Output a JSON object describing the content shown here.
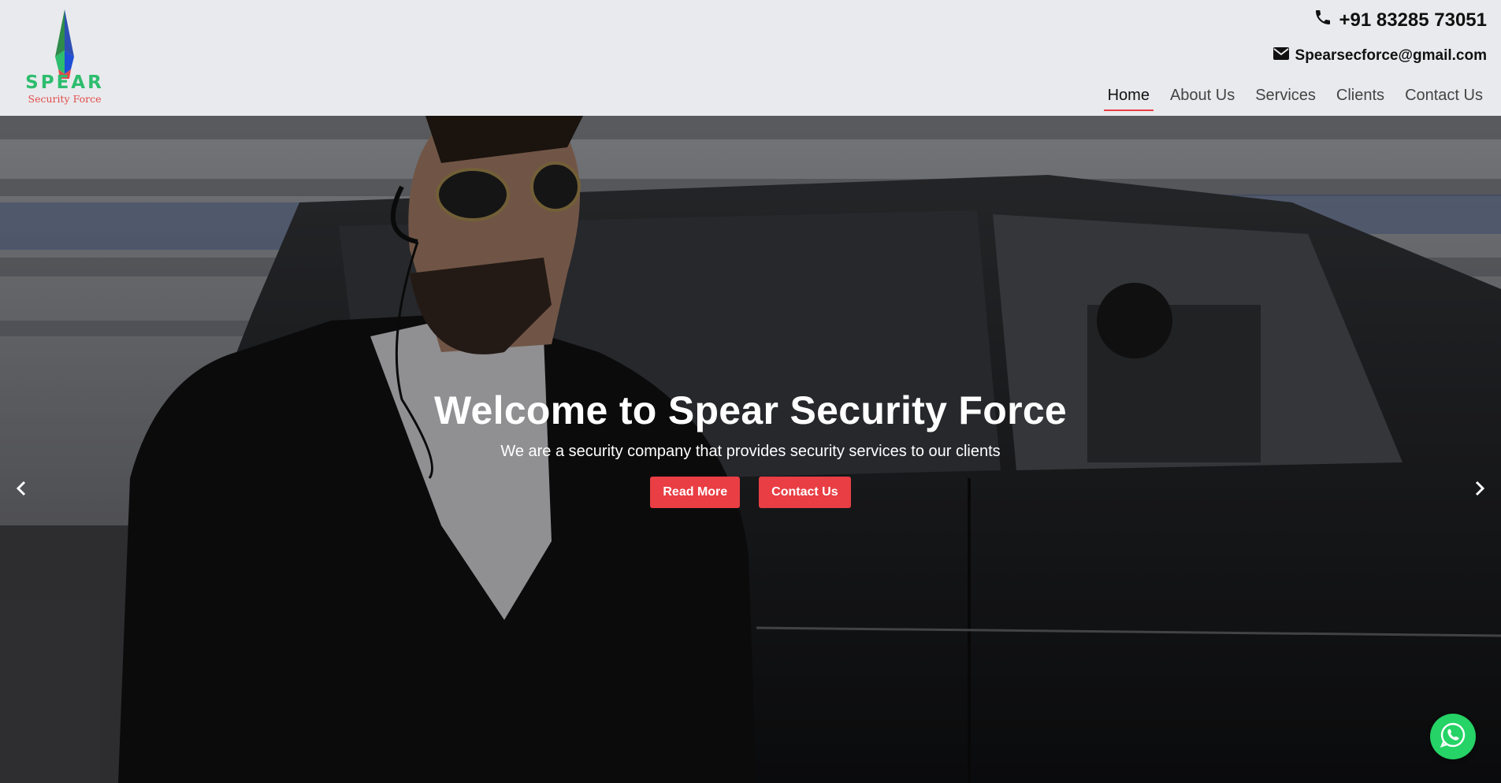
{
  "header": {
    "logo": {
      "word": "SPEAR",
      "tagline": "Security Force"
    },
    "phone": {
      "icon": "phone-icon",
      "text": "+91 83285 73051"
    },
    "email": {
      "icon": "envelope-icon",
      "text": "Spearsecforce@gmail.com"
    },
    "nav": [
      {
        "label": "Home",
        "active": true
      },
      {
        "label": "About Us",
        "active": false
      },
      {
        "label": "Services",
        "active": false
      },
      {
        "label": "Clients",
        "active": false
      },
      {
        "label": "Contact Us",
        "active": false
      }
    ]
  },
  "hero": {
    "title": "Welcome to Spear Security Force",
    "subtitle": "We are a security company that provides security services to our clients",
    "buttons": {
      "read_more": "Read More",
      "contact_us": "Contact Us"
    },
    "prev_icon": "chevron-left-icon",
    "next_icon": "chevron-right-icon"
  },
  "floating": {
    "whatsapp_icon": "whatsapp-icon"
  },
  "colors": {
    "accent": "#e83e44",
    "header_bg": "#e9eaed",
    "whatsapp": "#25d366"
  }
}
